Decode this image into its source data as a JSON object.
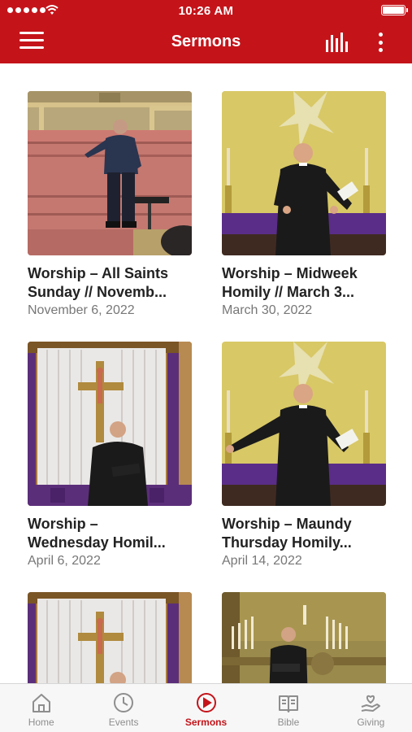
{
  "status_bar": {
    "time": "10:26 AM"
  },
  "header": {
    "title": "Sermons"
  },
  "sermons": [
    {
      "title_line1": "Worship – All Saints",
      "title_line2": "Sunday // Novemb...",
      "date": "November 6, 2022"
    },
    {
      "title_line1": "Worship – Midweek",
      "title_line2": "Homily // March 3...",
      "date": "March 30, 2022"
    },
    {
      "title_line1": "Worship –",
      "title_line2": "Wednesday Homil...",
      "date": "April 6, 2022"
    },
    {
      "title_line1": "Worship – Maundy",
      "title_line2": "Thursday Homily...",
      "date": "April 14, 2022"
    }
  ],
  "tabs": [
    {
      "label": "Home",
      "icon": "home-icon"
    },
    {
      "label": "Events",
      "icon": "clock-icon"
    },
    {
      "label": "Sermons",
      "icon": "play-circle-icon"
    },
    {
      "label": "Bible",
      "icon": "book-icon"
    },
    {
      "label": "Giving",
      "icon": "heart-hand-icon"
    }
  ],
  "colors": {
    "brand": "#c4141a",
    "tab_inactive": "#8e8e8e"
  }
}
